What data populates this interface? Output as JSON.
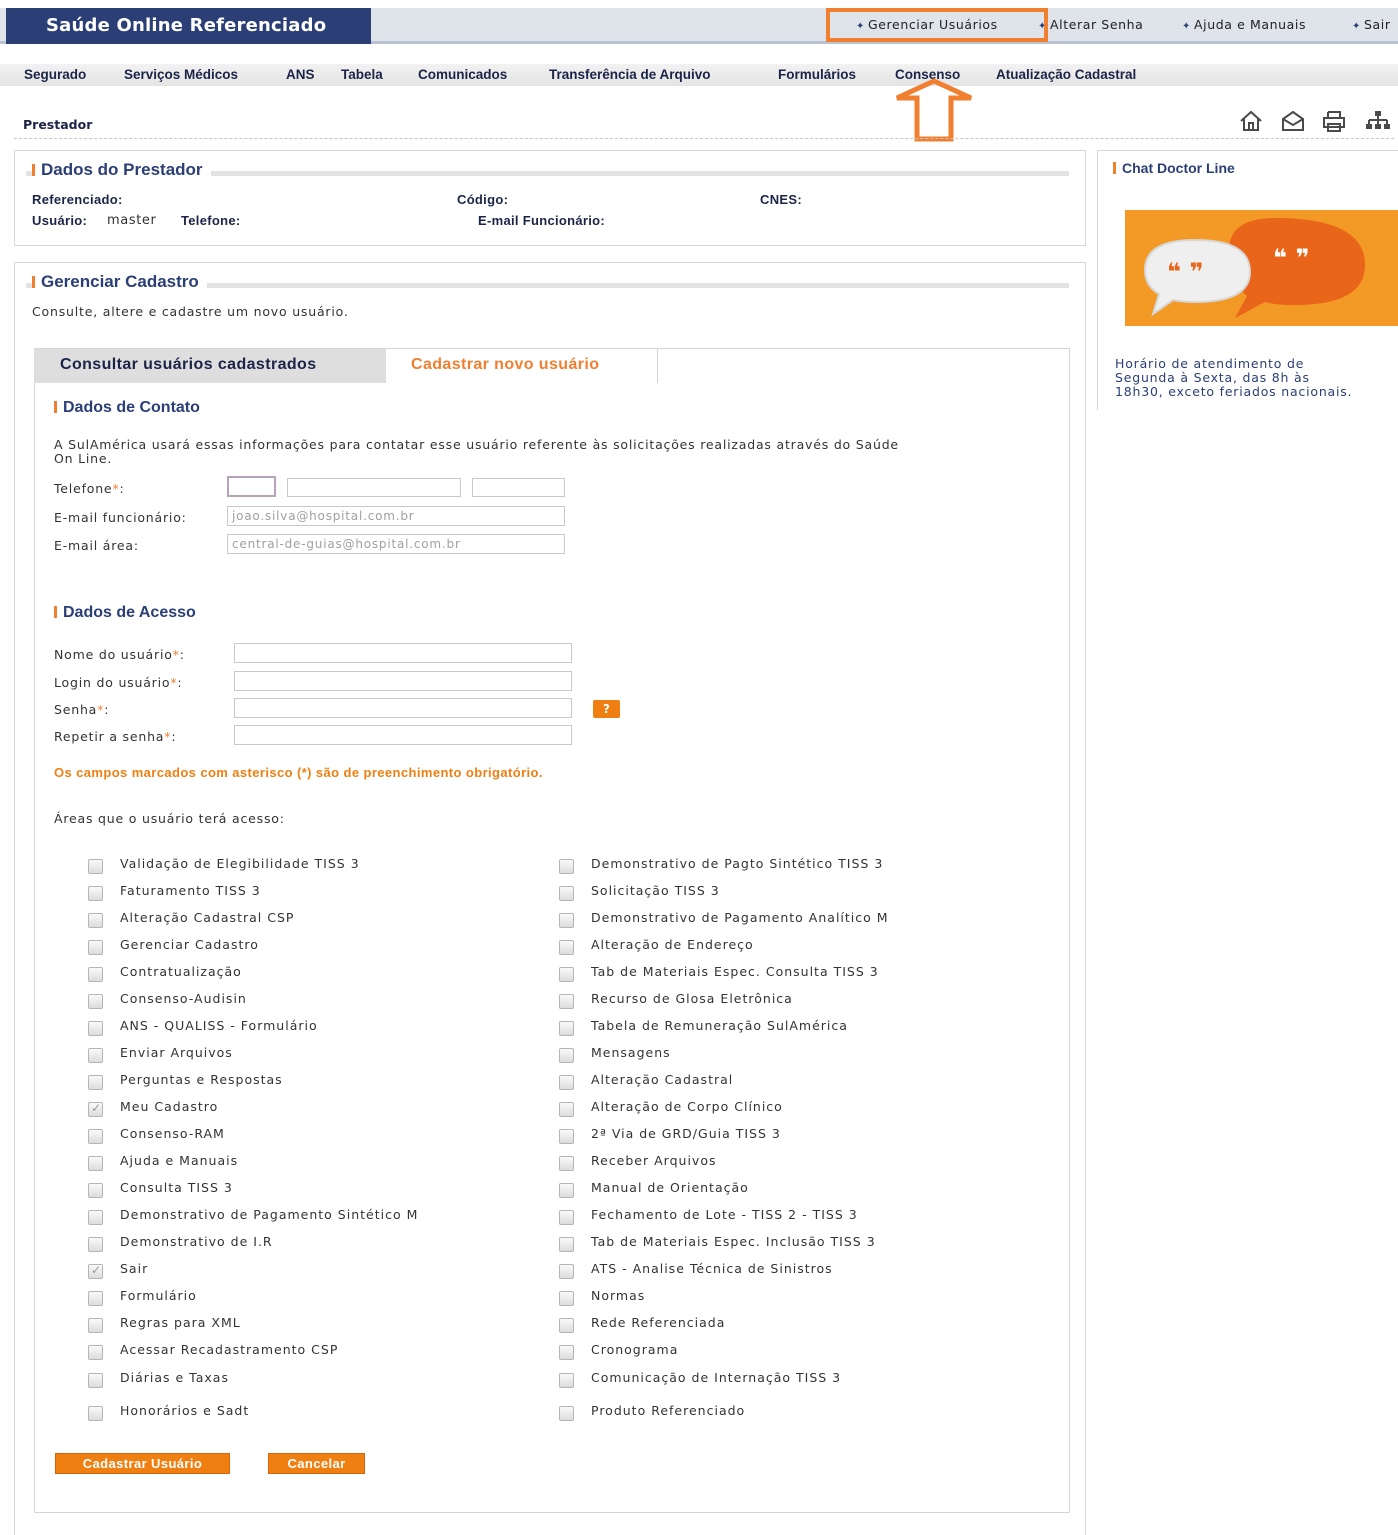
{
  "header": {
    "brand": "Saúde Online Referenciado",
    "links": [
      {
        "label": "Gerenciar Usuários"
      },
      {
        "label": "Alterar Senha"
      },
      {
        "label": "Ajuda e Manuais"
      },
      {
        "label": "Sair"
      }
    ]
  },
  "nav": {
    "items": [
      "Segurado",
      "Serviços Médicos",
      "ANS",
      "Tabela",
      "Comunicados",
      "Transferência de Arquivo",
      "Formulários",
      "Consenso",
      "Atualização Cadastral"
    ]
  },
  "breadcrumb": "Prestador",
  "toolbar_icons": [
    "home-icon",
    "mail-icon",
    "print-icon",
    "sitemap-icon"
  ],
  "prestador": {
    "title": "Dados do Prestador",
    "referenciado_label": "Referenciado:",
    "codigo_label": "Código:",
    "cnes_label": "CNES:",
    "usuario_label": "Usuário:",
    "usuario_value": "master",
    "telefone_label": "Telefone:",
    "email_func_label": "E-mail Funcionário:"
  },
  "chat": {
    "title": "Chat Doctor Line",
    "hours": [
      "Horário de atendimento de",
      "Segunda à Sexta, das 8h às",
      "18h30, exceto feriados nacionais."
    ]
  },
  "cadastro": {
    "title": "Gerenciar Cadastro",
    "description": "Consulte, altere e cadastre um novo usuário.",
    "tabs": [
      {
        "label": "Consultar usuários cadastrados",
        "active": false
      },
      {
        "label": "Cadastrar novo usuário",
        "active": true
      }
    ],
    "contato": {
      "title": "Dados de Contato",
      "info_line1": "A SulAmérica usará essas informações para contatar esse usuário referente às solicitações realizadas através do Saúde",
      "info_line2": "On Line.",
      "telefone_label": "Telefone",
      "email_func_label": "E-mail funcionário:",
      "email_func_placeholder": "joao.silva@hospital.com.br",
      "email_area_label": "E-mail área:",
      "email_area_placeholder": "central-de-guias@hospital.com.br"
    },
    "acesso": {
      "title": "Dados de Acesso",
      "nome_label": "Nome do usuário",
      "login_label": "Login do usuário",
      "senha_label": "Senha",
      "repetir_label": "Repetir a senha",
      "help_label": "?",
      "required_note": "Os campos marcados com asterisco (*) são de preenchimento obrigatório.",
      "areas_label": "Áreas que o usuário terá acesso:"
    },
    "areas_left": [
      {
        "label": "Validação de Elegibilidade TISS 3",
        "checked": false
      },
      {
        "label": "Faturamento TISS 3",
        "checked": false
      },
      {
        "label": "Alteração Cadastral CSP",
        "checked": false
      },
      {
        "label": "Gerenciar Cadastro",
        "checked": false
      },
      {
        "label": "Contratualização",
        "checked": false
      },
      {
        "label": "Consenso-Audisin",
        "checked": false
      },
      {
        "label": "ANS - QUALISS - Formulário",
        "checked": false
      },
      {
        "label": "Enviar Arquivos",
        "checked": false
      },
      {
        "label": "Perguntas e Respostas",
        "checked": false
      },
      {
        "label": "Meu Cadastro",
        "checked": true
      },
      {
        "label": "Consenso-RAM",
        "checked": false
      },
      {
        "label": "Ajuda e Manuais",
        "checked": false
      },
      {
        "label": "Consulta TISS 3",
        "checked": false
      },
      {
        "label": "Demonstrativo de Pagamento Sintético M",
        "checked": false
      },
      {
        "label": "Demonstrativo de I.R",
        "checked": false
      },
      {
        "label": "Sair",
        "checked": true
      },
      {
        "label": "Formulário",
        "checked": false
      },
      {
        "label": "Regras para XML",
        "checked": false
      },
      {
        "label": "Acessar Recadastramento CSP",
        "checked": false
      },
      {
        "label": "Diárias e Taxas",
        "checked": false
      },
      {
        "label": "Honorários e Sadt",
        "checked": false
      }
    ],
    "areas_right": [
      {
        "label": "Demonstrativo de Pagto Sintético TISS 3",
        "checked": false
      },
      {
        "label": "Solicitação TISS 3",
        "checked": false
      },
      {
        "label": "Demonstrativo de Pagamento Analítico M",
        "checked": false
      },
      {
        "label": "Alteração de Endereço",
        "checked": false
      },
      {
        "label": "Tab de Materiais Espec. Consulta TISS 3",
        "checked": false
      },
      {
        "label": "Recurso de Glosa Eletrônica",
        "checked": false
      },
      {
        "label": "Tabela de Remuneração SulAmérica",
        "checked": false
      },
      {
        "label": "Mensagens",
        "checked": false
      },
      {
        "label": "Alteração Cadastral",
        "checked": false
      },
      {
        "label": "Alteração de Corpo Clínico",
        "checked": false
      },
      {
        "label": "2ª Via de GRD/Guia TISS 3",
        "checked": false
      },
      {
        "label": "Receber Arquivos",
        "checked": false
      },
      {
        "label": "Manual de Orientação",
        "checked": false
      },
      {
        "label": "Fechamento de Lote - TISS 2 - TISS 3",
        "checked": false
      },
      {
        "label": "Tab de Materiais Espec. Inclusão TISS 3",
        "checked": false
      },
      {
        "label": "ATS - Analise Técnica de Sinistros",
        "checked": false
      },
      {
        "label": "Normas",
        "checked": false
      },
      {
        "label": "Rede Referenciada",
        "checked": false
      },
      {
        "label": "Cronograma",
        "checked": false
      },
      {
        "label": "Comunicação de Internação TISS 3",
        "checked": false
      },
      {
        "label": "Produto Referenciado",
        "checked": false
      }
    ],
    "buttons": {
      "submit": "Cadastrar Usuário",
      "cancel": "Cancelar"
    }
  },
  "colors": {
    "brand_blue": "#2b3f76",
    "accent_orange": "#f07f30",
    "nav_text": "#1b2447"
  }
}
